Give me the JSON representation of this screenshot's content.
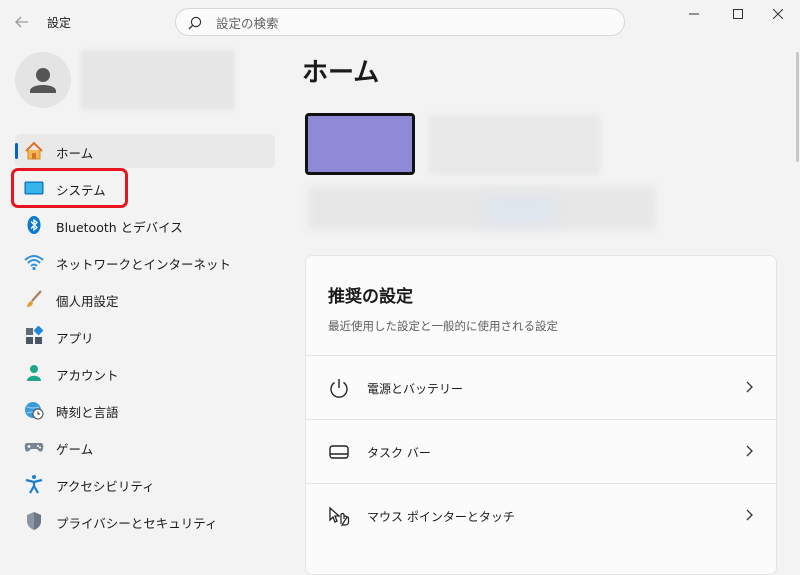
{
  "window": {
    "title": "設定",
    "controls": [
      "minimize-icon",
      "maximize-icon",
      "close-icon"
    ]
  },
  "search": {
    "placeholder": "設定の検索"
  },
  "sidebar": {
    "items": [
      {
        "label": "ホーム",
        "icon": "home-icon",
        "active": true
      },
      {
        "label": "システム",
        "icon": "system-icon",
        "active": false,
        "highlighted": true
      },
      {
        "label": "Bluetooth とデバイス",
        "icon": "bluetooth-icon",
        "active": false
      },
      {
        "label": "ネットワークとインターネット",
        "icon": "wifi-icon",
        "active": false
      },
      {
        "label": "個人用設定",
        "icon": "brush-icon",
        "active": false
      },
      {
        "label": "アプリ",
        "icon": "apps-icon",
        "active": false
      },
      {
        "label": "アカウント",
        "icon": "account-icon",
        "active": false
      },
      {
        "label": "時刻と言語",
        "icon": "globe-clock-icon",
        "active": false
      },
      {
        "label": "ゲーム",
        "icon": "gamepad-icon",
        "active": false
      },
      {
        "label": "アクセシビリティ",
        "icon": "accessibility-icon",
        "active": false
      },
      {
        "label": "プライバシーとセキュリティ",
        "icon": "shield-icon",
        "active": false
      }
    ]
  },
  "main": {
    "title": "ホーム",
    "recommended": {
      "title": "推奨の設定",
      "subtitle": "最近使用した設定と一般的に使用される設定",
      "items": [
        {
          "label": "電源とバッテリー",
          "icon": "power-icon"
        },
        {
          "label": "タスク バー",
          "icon": "taskbar-icon"
        },
        {
          "label": "マウス ポインターとタッチ",
          "icon": "pointer-touch-icon"
        }
      ]
    }
  },
  "colors": {
    "accent": "#0067c0",
    "highlight": "#e8141f",
    "device": "#8f89d8"
  }
}
